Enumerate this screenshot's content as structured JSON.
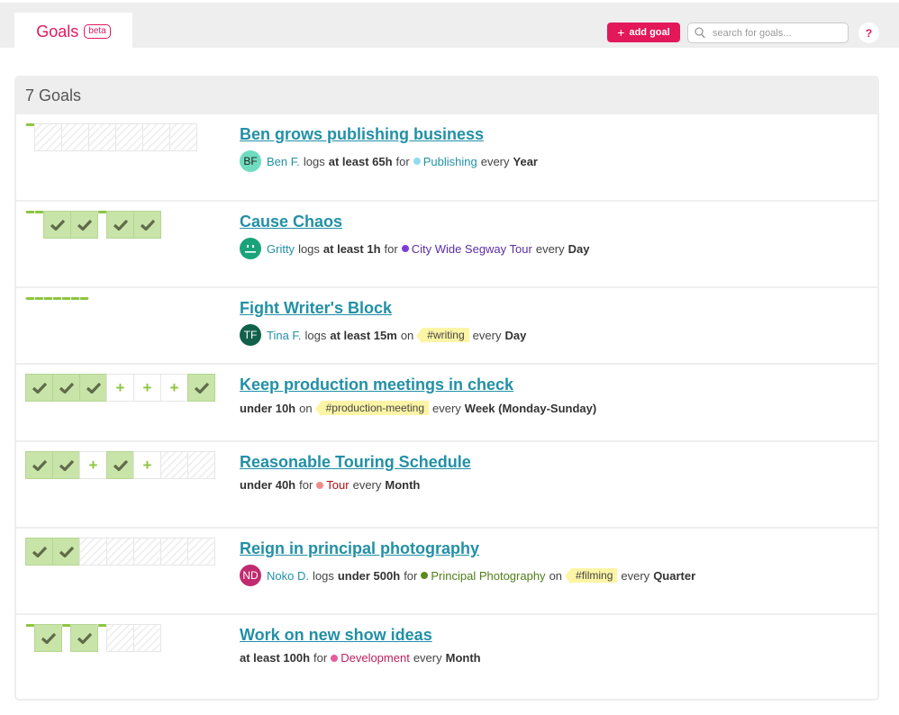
{
  "header": {
    "tab_title": "Goals",
    "beta_label": "beta",
    "add_goal_label": "add goal",
    "search_placeholder": "search for goals...",
    "help_label": "?"
  },
  "colors": {
    "brand": "#e2185b",
    "link": "#2290a6",
    "done_cell": "#c8e4a8",
    "mark": "#8cc63f",
    "tag_bg": "#fdf5a6"
  },
  "panel": {
    "title": "7 Goals"
  },
  "goals": [
    {
      "title": "Ben grows publishing business",
      "streak": [
        "dash",
        "empty",
        "empty",
        "empty",
        "empty",
        "empty",
        "empty"
      ],
      "user": {
        "initials": "BF",
        "name": "Ben F.",
        "avatar_color": "#6fdcc0",
        "initials_color": "#222"
      },
      "verb": "logs",
      "amount": "at least 65h",
      "connector": "for",
      "project": {
        "name": "Publishing",
        "color": "#8fdcf0",
        "text_color": "#2290a6"
      },
      "tag": null,
      "every_label": "every",
      "period": "Year"
    },
    {
      "title": "Cause Chaos",
      "streak": [
        "dash",
        "dash",
        "done",
        "done",
        "dash",
        "done",
        "done"
      ],
      "user": {
        "initials": "",
        "name": "Gritty",
        "avatar_color": "#1aa37a",
        "initials_color": "#fff",
        "smiley": true
      },
      "verb": "logs",
      "amount": "at least 1h",
      "connector": "for",
      "project": {
        "name": "City Wide Segway Tour",
        "color": "#7c3fd6",
        "text_color": "#5b2fa8"
      },
      "tag": null,
      "every_label": "every",
      "period": "Day"
    },
    {
      "title": "Fight Writer's Block",
      "streak": [
        "dash",
        "dash",
        "dash",
        "dash",
        "dash",
        "dash",
        "dash"
      ],
      "user": {
        "initials": "TF",
        "name": "Tina F.",
        "avatar_color": "#11604a",
        "initials_color": "#fff"
      },
      "verb": "logs",
      "amount": "at least 15m",
      "connector": "on",
      "project": null,
      "tag": "#writing",
      "every_label": "every",
      "period": "Day"
    },
    {
      "title": "Keep production meetings in check",
      "streak": [
        "done",
        "done",
        "done",
        "plus",
        "plus",
        "plus",
        "done"
      ],
      "user": null,
      "verb": "",
      "amount": "under 10h",
      "connector": "on",
      "project": null,
      "tag": "#production-meeting",
      "every_label": "every",
      "period": "Week (Monday-Sunday)"
    },
    {
      "title": "Reasonable Touring Schedule",
      "streak": [
        "done",
        "done",
        "plus",
        "done",
        "plus",
        "empty",
        "empty"
      ],
      "user": null,
      "verb": "",
      "amount": "under 40h",
      "connector": "for",
      "project": {
        "name": "Tour",
        "color": "#f28c8c",
        "text_color": "#b0101a"
      },
      "tag": null,
      "every_label": "every",
      "period": "Month"
    },
    {
      "title": "Reign in principal photography",
      "streak": [
        "done",
        "done",
        "empty",
        "empty",
        "empty",
        "empty",
        "empty"
      ],
      "user": {
        "initials": "ND",
        "name": "Noko D.",
        "avatar_color": "#c02a6e",
        "initials_color": "#fff"
      },
      "verb": "logs",
      "amount": "under 500h",
      "connector": "for",
      "project": {
        "name": "Principal Photography",
        "color": "#5a8a1e",
        "text_color": "#4f7d18"
      },
      "tag_connector": "on",
      "tag": "#filming",
      "every_label": "every",
      "period": "Quarter"
    },
    {
      "title": "Work on new show ideas",
      "streak": [
        "dash",
        "done",
        "dash",
        "done",
        "dash",
        "empty",
        "empty"
      ],
      "user": null,
      "verb": "",
      "amount": "at least 100h",
      "connector": "for",
      "project": {
        "name": "Development",
        "color": "#e85b9c",
        "text_color": "#b8225f"
      },
      "tag": null,
      "every_label": "every",
      "period": "Month"
    }
  ]
}
